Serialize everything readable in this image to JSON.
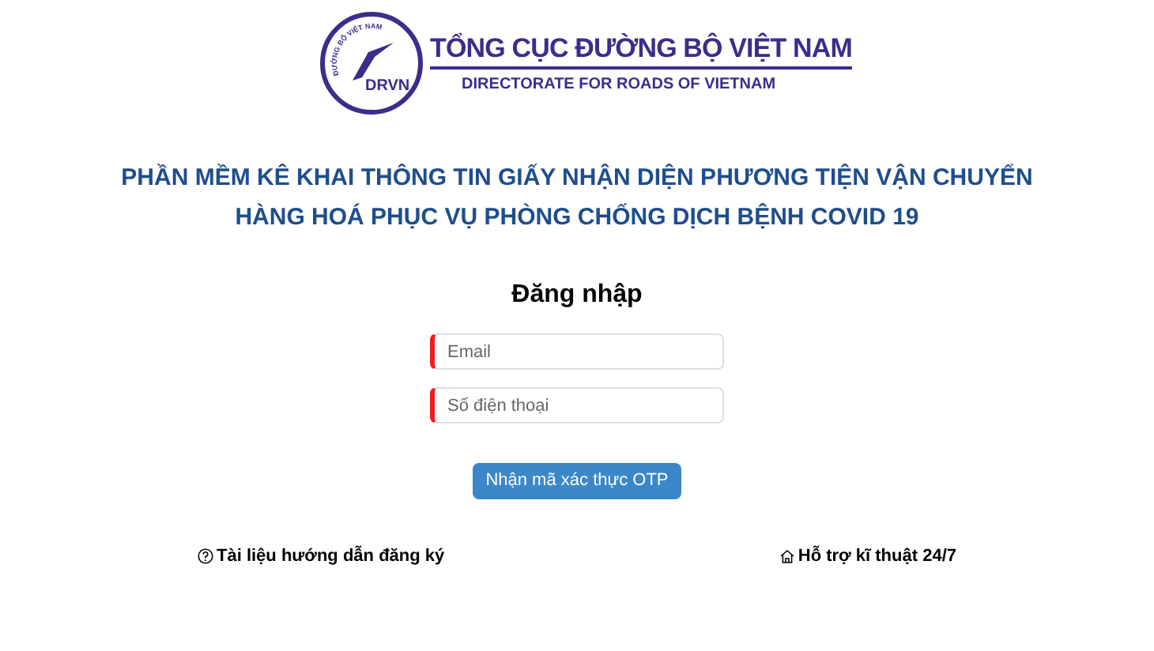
{
  "logo": {
    "emblem_arc": "ĐƯỜNG BỘ VIỆT NAM",
    "emblem_code": "DRVN",
    "title": "TỔNG CỤC ĐƯỜNG BỘ VIỆT NAM",
    "subtitle": "DIRECTORATE FOR ROADS OF VIETNAM"
  },
  "heading_lines": [
    "PHẦN MỀM KÊ KHAI THÔNG TIN GIẤY NHẬN DIỆN PHƯƠNG TIỆN VẬN CHUYỂN",
    "HÀNG HOÁ PHỤC VỤ PHÒNG CHỐNG DỊCH BỆNH COVID 19"
  ],
  "form": {
    "title": "Đăng nhập",
    "fields": [
      {
        "placeholder": "Email",
        "required": true
      },
      {
        "placeholder": "Số điện thoại",
        "required": true
      }
    ],
    "button": "Nhận mã xác thực OTP"
  },
  "footer_links": [
    {
      "kind": "help",
      "label": "Tài liệu hướng dẫn đăng ký"
    },
    {
      "kind": "support",
      "label": "Hỗ trợ kĩ thuật 24/7"
    }
  ]
}
